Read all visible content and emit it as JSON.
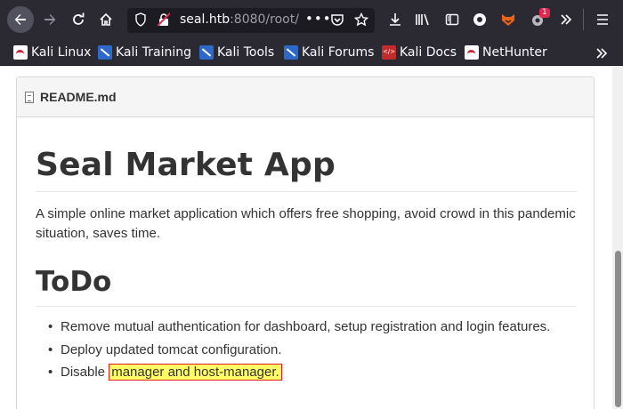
{
  "toolbar": {
    "url_host": "seal.htb",
    "url_rest": ":8080/root/",
    "notification_badge": "1",
    "icons": [
      "back-icon",
      "forward-icon",
      "reload-icon",
      "home-icon",
      "shield-icon",
      "insecure-lock-icon",
      "page-actions-icon",
      "pocket-icon",
      "bookmark-star-icon",
      "download-icon",
      "library-icon",
      "sidebar-icon",
      "extension-circle-icon",
      "foxyproxy-icon",
      "extension-badge-icon",
      "overflow-icon",
      "menu-icon"
    ]
  },
  "bookmarks": [
    {
      "label": "Kali Linux",
      "icon": "kali-icon"
    },
    {
      "label": "Kali Training",
      "icon": "kali-training-icon"
    },
    {
      "label": "Kali Tools",
      "icon": "kali-tools-icon"
    },
    {
      "label": "Kali Forums",
      "icon": "kali-forums-icon"
    },
    {
      "label": "Kali Docs",
      "icon": "kali-docs-icon"
    },
    {
      "label": "NetHunter",
      "icon": "nethunter-icon"
    }
  ],
  "readme": {
    "filename": "README.md",
    "title": "Seal Market App",
    "description": "A simple online market application which offers free shopping, avoid crowd in this pandemic situation, saves time.",
    "todo_heading": "ToDo",
    "todo_items": [
      "Remove mutual authentication for dashboard, setup registration and login features.",
      "Deploy updated tomcat configuration."
    ],
    "todo_last_prefix": "Disable",
    "todo_last_highlight": "manager and host-manager."
  },
  "colors": {
    "highlight": "#ffff66",
    "highlight_border": "#e02020",
    "chrome_bg": "#2b2a33"
  }
}
